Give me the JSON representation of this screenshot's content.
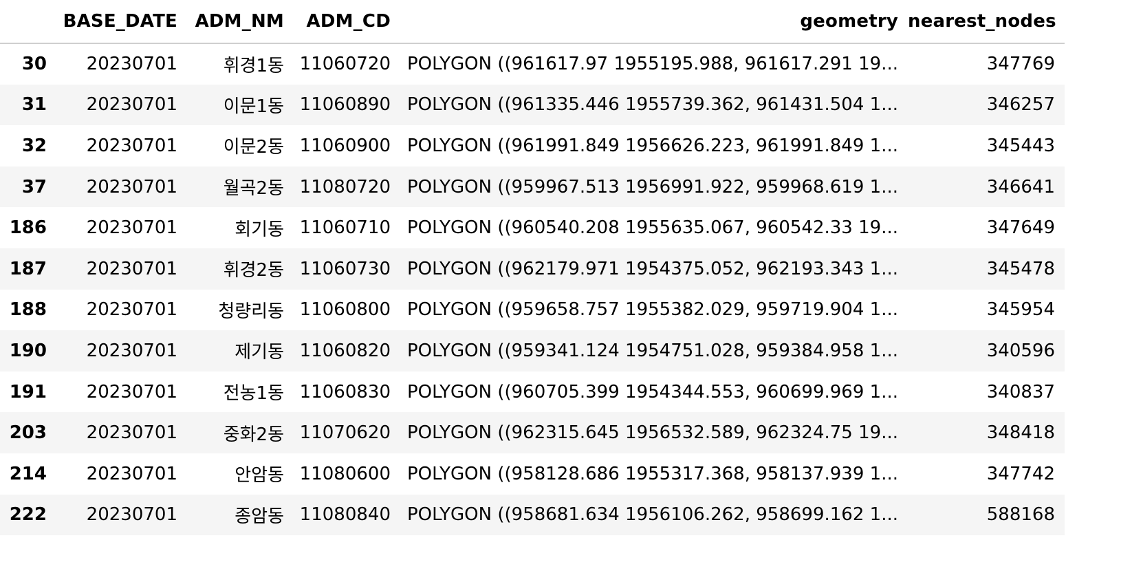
{
  "table": {
    "index_header": "",
    "columns": [
      "BASE_DATE",
      "ADM_NM",
      "ADM_CD",
      "geometry",
      "nearest_nodes"
    ],
    "rows": [
      {
        "index": "30",
        "cells": [
          "20230701",
          "휘경1동",
          "11060720",
          "POLYGON ((961617.97 1955195.988, 961617.291 19...",
          "347769"
        ]
      },
      {
        "index": "31",
        "cells": [
          "20230701",
          "이문1동",
          "11060890",
          "POLYGON ((961335.446 1955739.362, 961431.504 1...",
          "346257"
        ]
      },
      {
        "index": "32",
        "cells": [
          "20230701",
          "이문2동",
          "11060900",
          "POLYGON ((961991.849 1956626.223, 961991.849 1...",
          "345443"
        ]
      },
      {
        "index": "37",
        "cells": [
          "20230701",
          "월곡2동",
          "11080720",
          "POLYGON ((959967.513 1956991.922, 959968.619 1...",
          "346641"
        ]
      },
      {
        "index": "186",
        "cells": [
          "20230701",
          "회기동",
          "11060710",
          "POLYGON ((960540.208 1955635.067, 960542.33 19...",
          "347649"
        ]
      },
      {
        "index": "187",
        "cells": [
          "20230701",
          "휘경2동",
          "11060730",
          "POLYGON ((962179.971 1954375.052, 962193.343 1...",
          "345478"
        ]
      },
      {
        "index": "188",
        "cells": [
          "20230701",
          "청량리동",
          "11060800",
          "POLYGON ((959658.757 1955382.029, 959719.904 1...",
          "345954"
        ]
      },
      {
        "index": "190",
        "cells": [
          "20230701",
          "제기동",
          "11060820",
          "POLYGON ((959341.124 1954751.028, 959384.958 1...",
          "340596"
        ]
      },
      {
        "index": "191",
        "cells": [
          "20230701",
          "전농1동",
          "11060830",
          "POLYGON ((960705.399 1954344.553, 960699.969 1...",
          "340837"
        ]
      },
      {
        "index": "203",
        "cells": [
          "20230701",
          "중화2동",
          "11070620",
          "POLYGON ((962315.645 1956532.589, 962324.75 19...",
          "348418"
        ]
      },
      {
        "index": "214",
        "cells": [
          "20230701",
          "안암동",
          "11080600",
          "POLYGON ((958128.686 1955317.368, 958137.939 1...",
          "347742"
        ]
      },
      {
        "index": "222",
        "cells": [
          "20230701",
          "종암동",
          "11080840",
          "POLYGON ((958681.634 1956106.262, 958699.162 1...",
          "588168"
        ]
      }
    ]
  }
}
